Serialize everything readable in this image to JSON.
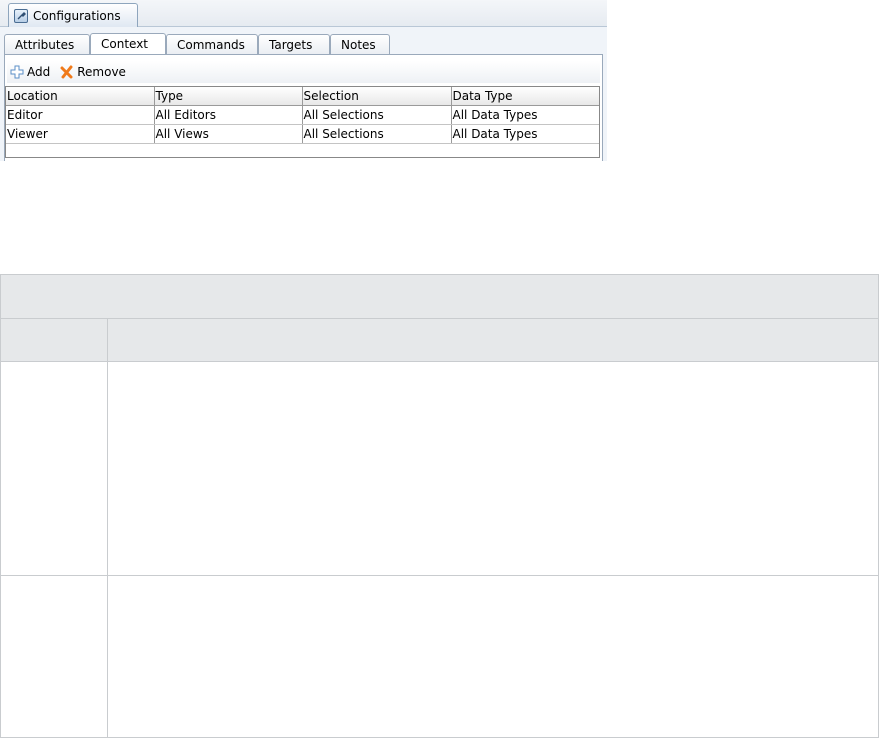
{
  "outer_tab": {
    "label": "Configurations",
    "icon": "wrench-icon"
  },
  "subtabs": [
    {
      "label": "Attributes",
      "active": false
    },
    {
      "label": "Context",
      "active": true
    },
    {
      "label": "Commands",
      "active": false
    },
    {
      "label": "Targets",
      "active": false
    },
    {
      "label": "Notes",
      "active": false
    }
  ],
  "toolbar": {
    "add_label": "Add",
    "remove_label": "Remove"
  },
  "grid": {
    "columns": [
      "Location",
      "Type",
      "Selection",
      "Data Type"
    ],
    "rows": [
      [
        "Editor",
        "All Editors",
        "All Selections",
        "All Data Types"
      ],
      [
        "Viewer",
        "All Views",
        "All Selections",
        "All Data Types"
      ]
    ]
  },
  "colors": {
    "add_icon": "#5b8fc7",
    "remove_icon": "#f07a1a",
    "header_fill": "#e6e8ea"
  }
}
